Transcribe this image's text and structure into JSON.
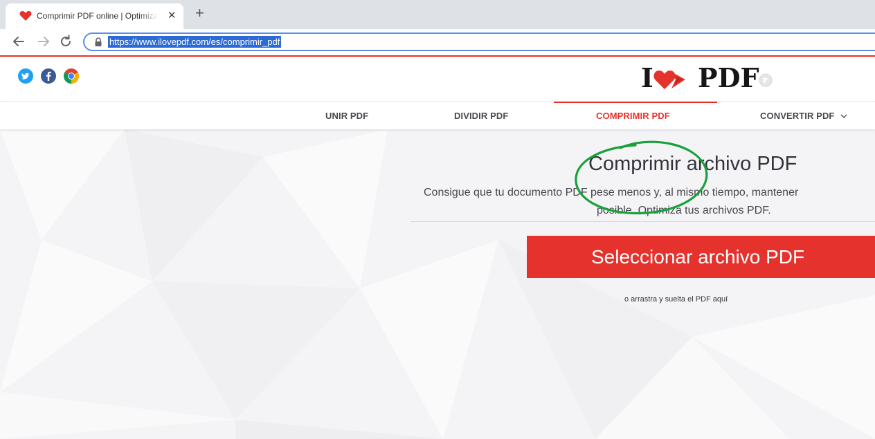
{
  "browser": {
    "tab": {
      "title": "Comprimir PDF online | Optimizar PDF",
      "close": "✕"
    },
    "new_tab": "+",
    "address": {
      "url": "https://www.ilovepdf.com/es/comprimir_pdf"
    }
  },
  "site": {
    "logo": {
      "left": "I",
      "right": "PDF"
    },
    "social_icons": [
      "twitter-icon",
      "facebook-icon",
      "chrome-icon"
    ],
    "nav": {
      "items": [
        "UNIR PDF",
        "DIVIDIR PDF",
        "COMPRIMIR PDF",
        "CONVERTIR PDF"
      ],
      "active": "COMPRIMIR PDF"
    },
    "main": {
      "title": "Comprimir archivo PDF",
      "subtitle_line1": "Consigue que tu documento PDF pese menos y, al mismo tiempo, mantener",
      "subtitle_line2": "posible. Optimiza tus archivos PDF.",
      "select_button": "Seleccionar archivo PDF",
      "drag_hint": "o arrastra y suelta el PDF aquí"
    }
  },
  "colors": {
    "brand_red": "#e5322d",
    "annotation_green": "#1aa03a",
    "url_highlight": "#2c6bd6"
  }
}
